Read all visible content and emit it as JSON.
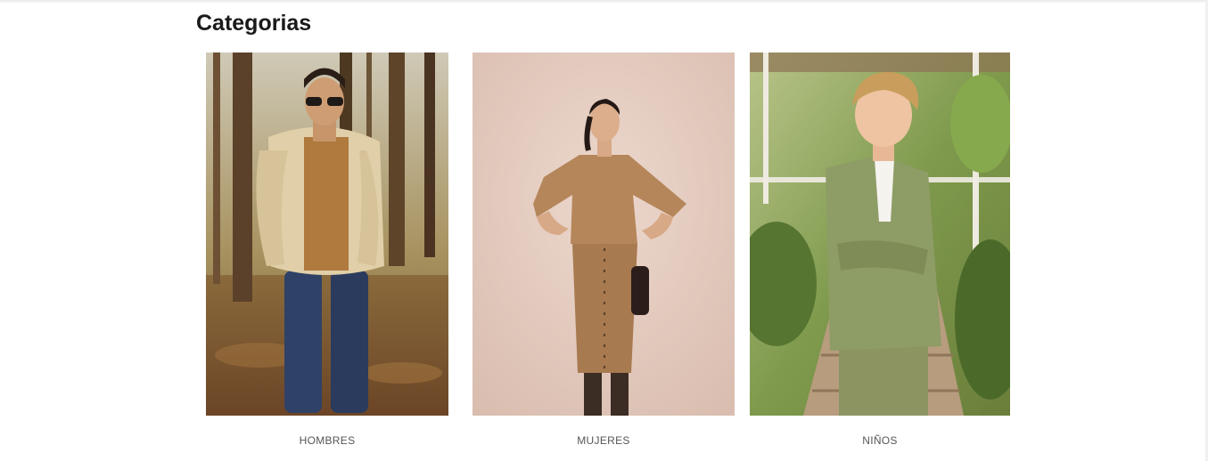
{
  "section": {
    "title": "Categorias"
  },
  "categories": [
    {
      "label": "HOMBRES",
      "image": "man-in-forest-photo"
    },
    {
      "label": "MUJERES",
      "image": "woman-in-camel-dress-photo"
    },
    {
      "label": "NIÑOS",
      "image": "boy-in-green-suit-photo"
    }
  ],
  "colors": {
    "title": "#1a1a1a",
    "label": "#555555",
    "background": "#ffffff"
  }
}
